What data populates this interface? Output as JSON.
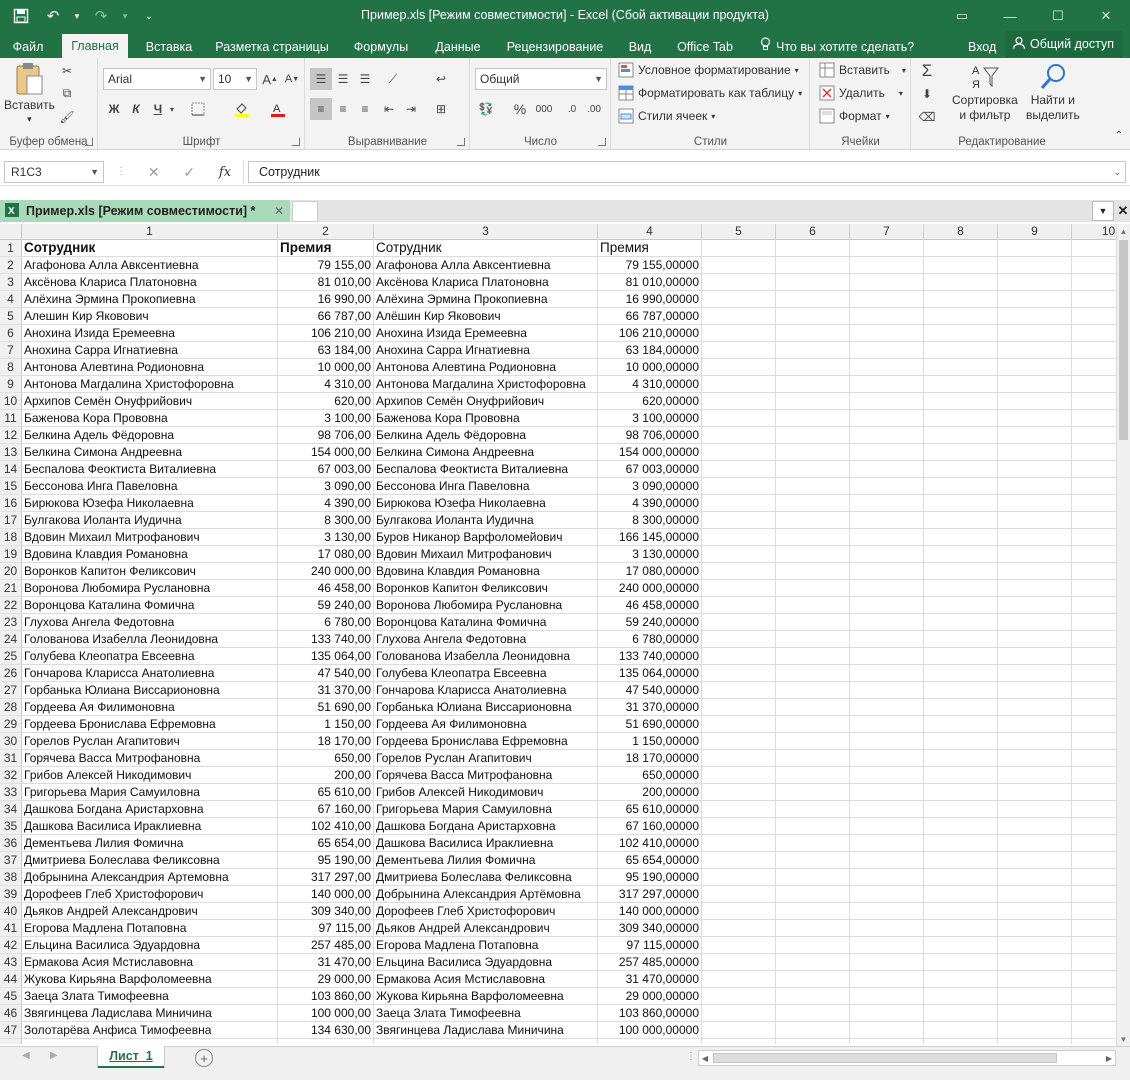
{
  "window": {
    "title": "Пример.xls  [Режим совместимости] - Excel (Сбой активации продукта)",
    "quick_access": [
      "save-icon",
      "undo-icon",
      "redo-icon",
      "customize-qat-icon"
    ]
  },
  "tabs": {
    "file": "Файл",
    "home": "Главная",
    "insert": "Вставка",
    "page_layout": "Разметка страницы",
    "formulas": "Формулы",
    "data": "Данные",
    "review": "Рецензирование",
    "view": "Вид",
    "office_tab": "Office Tab",
    "tell_me": "Что вы хотите сделать?",
    "sign_in": "Вход",
    "share": "Общий доступ"
  },
  "ribbon": {
    "clipboard": {
      "label": "Буфер обмена",
      "paste": "Вставить"
    },
    "font": {
      "label": "Шрифт",
      "font_name": "Arial",
      "font_size": "10",
      "bold": "Ж",
      "italic": "К",
      "underline": "Ч"
    },
    "alignment": {
      "label": "Выравнивание"
    },
    "number": {
      "label": "Число",
      "format": "Общий",
      "percent": "%",
      "thousands": "000"
    },
    "styles": {
      "label": "Стили",
      "conditional": "Условное форматирование",
      "as_table": "Форматировать как таблицу",
      "cell_styles": "Стили ячеек"
    },
    "cells": {
      "label": "Ячейки",
      "insert": "Вставить",
      "delete": "Удалить",
      "format": "Формат"
    },
    "editing": {
      "label": "Редактирование",
      "sort_line1": "Сортировка",
      "sort_line2": "и фильтр",
      "find_line1": "Найти и",
      "find_line2": "выделить"
    }
  },
  "formula_bar": {
    "name_box": "R1C3",
    "fx": "fx",
    "content": "Сотрудник"
  },
  "workbook_tab": {
    "name": "Пример.xls  [Режим совместимости] *"
  },
  "sheet": {
    "column_headers": [
      "1",
      "2",
      "3",
      "4",
      "5",
      "6",
      "7",
      "8",
      "9",
      "10"
    ],
    "header_row": [
      "Сотрудник",
      "Премия",
      "Сотрудник",
      "Премия"
    ],
    "rows": [
      [
        "Агафонова Алла Авксентиевна",
        "79 155,00",
        "Агафонова Алла Авксентиевна",
        "79 155,00000"
      ],
      [
        "Аксёнова Клариса Платоновна",
        "81 010,00",
        "Аксёнова Клариса Платоновна",
        "81 010,00000"
      ],
      [
        "Алёхина Эрмина Прокопиевна",
        "16 990,00",
        "Алёхина Эрмина Прокопиевна",
        "16 990,00000"
      ],
      [
        "Алешин Кир Яковович",
        "66 787,00",
        "Алёшин Кир Яковович",
        "66 787,00000"
      ],
      [
        "Анохина Изида Еремеевна",
        "106 210,00",
        "Анохина Изида Еремеевна",
        "106 210,00000"
      ],
      [
        "Анохина Сарра Игнатиевна",
        "63 184,00",
        "Анохина Сарра Игнатиевна",
        "63 184,00000"
      ],
      [
        "Антонова Алевтина Родионовна",
        "10 000,00",
        "Антонова Алевтина Родионовна",
        "10 000,00000"
      ],
      [
        "Антонова Магдалина Христофоровна",
        "4 310,00",
        "Антонова Магдалина Христофоровна",
        "4 310,00000"
      ],
      [
        "Архипов Семён Онуфрийович",
        "620,00",
        "Архипов Семён Онуфрийович",
        "620,00000"
      ],
      [
        "Баженова Кора Прововна",
        "3 100,00",
        "Баженова Кора Прововна",
        "3 100,00000"
      ],
      [
        "Белкина Адель Фёдоровна",
        "98 706,00",
        "Белкина Адель Фёдоровна",
        "98 706,00000"
      ],
      [
        "Белкина Симона Андреевна",
        "154 000,00",
        "Белкина Симона Андреевна",
        "154 000,00000"
      ],
      [
        "Беспалова Феоктиста Виталиевна",
        "67 003,00",
        "Беспалова Феоктиста Виталиевна",
        "67 003,00000"
      ],
      [
        "Бессонова Инга Павеловна",
        "3 090,00",
        "Бессонова Инга Павеловна",
        "3 090,00000"
      ],
      [
        "Бирюкова Юзефа Николаевна",
        "4 390,00",
        "Бирюкова Юзефа Николаевна",
        "4 390,00000"
      ],
      [
        "Булгакова Иоланта Иудична",
        "8 300,00",
        "Булгакова Иоланта Иудична",
        "8 300,00000"
      ],
      [
        "Вдовин Михаил Митрофанович",
        "3 130,00",
        "Буров Никанор Варфоломейович",
        "166 145,00000"
      ],
      [
        "Вдовина Клавдия Романовна",
        "17 080,00",
        "Вдовин Михаил Митрофанович",
        "3 130,00000"
      ],
      [
        "Воронков Капитон Феликсович",
        "240 000,00",
        "Вдовина Клавдия Романовна",
        "17 080,00000"
      ],
      [
        "Воронова Любомира Руслановна",
        "46 458,00",
        "Воронков Капитон Феликсович",
        "240 000,00000"
      ],
      [
        "Воронцова Каталина Фомична",
        "59 240,00",
        "Воронова Любомира Руслановна",
        "46 458,00000"
      ],
      [
        "Глухова Ангела Федотовна",
        "6 780,00",
        "Воронцова Каталина Фомична",
        "59 240,00000"
      ],
      [
        "Голованова Изабелла Леонидовна",
        "133 740,00",
        "Глухова Ангела Федотовна",
        "6 780,00000"
      ],
      [
        "Голубева Клеопатра Евсеевна",
        "135 064,00",
        "Голованова Изабелла Леонидовна",
        "133 740,00000"
      ],
      [
        "Гончарова Кларисса Анатолиевна",
        "47 540,00",
        "Голубева Клеопатра Евсеевна",
        "135 064,00000"
      ],
      [
        "Горбанька Юлиана Виссарионовна",
        "31 370,00",
        "Гончарова Кларисса Анатолиевна",
        "47 540,00000"
      ],
      [
        "Гордеева Ая Филимоновна",
        "51 690,00",
        "Горбанька Юлиана Виссарионовна",
        "31 370,00000"
      ],
      [
        "Гордеева Бронислава Ефремовна",
        "1 150,00",
        "Гордеева Ая Филимоновна",
        "51 690,00000"
      ],
      [
        "Горелов Руслан Агапитович",
        "18 170,00",
        "Гордеева Бронислава Ефремовна",
        "1 150,00000"
      ],
      [
        "Горячева Васса Митрофановна",
        "650,00",
        "Горелов Руслан Агапитович",
        "18 170,00000"
      ],
      [
        "Грибов Алексей Никодимович",
        "200,00",
        "Горячева Васса Митрофановна",
        "650,00000"
      ],
      [
        "Григорьева Мария Самуиловна",
        "65 610,00",
        "Грибов Алексей Никодимович",
        "200,00000"
      ],
      [
        "Дашкова Богдана Аристарховна",
        "67 160,00",
        "Григорьева Мария Самуиловна",
        "65 610,00000"
      ],
      [
        "Дашкова Василиса Ираклиевна",
        "102 410,00",
        "Дашкова Богдана Аристарховна",
        "67 160,00000"
      ],
      [
        "Дементьева Лилия Фомична",
        "65 654,00",
        "Дашкова Василиса Ираклиевна",
        "102 410,00000"
      ],
      [
        "Дмитриева Болеслава Феликсовна",
        "95 190,00",
        "Дементьева Лилия Фомична",
        "65 654,00000"
      ],
      [
        "Добрынина Александрия Артемовна",
        "317 297,00",
        "Дмитриева Болеслава Феликсовна",
        "95 190,00000"
      ],
      [
        "Дорофеев Глеб Христофорович",
        "140 000,00",
        "Добрынина Александрия Артёмовна",
        "317 297,00000"
      ],
      [
        "Дьяков Андрей Александрович",
        "309 340,00",
        "Дорофеев Глеб Христофорович",
        "140 000,00000"
      ],
      [
        "Егорова Мадлена Потаповна",
        "97 115,00",
        "Дьяков Андрей Александрович",
        "309 340,00000"
      ],
      [
        "Ельцина Василиса Эдуардовна",
        "257 485,00",
        "Егорова Мадлена Потаповна",
        "97 115,00000"
      ],
      [
        "Ермакова Асия Мстиславовна",
        "31 470,00",
        "Ельцина Василиса Эдуардовна",
        "257 485,00000"
      ],
      [
        "Жукова Кирьяна Варфоломеевна",
        "29 000,00",
        "Ермакова Асия Мстиславовна",
        "31 470,00000"
      ],
      [
        "Заеца Злата Тимофеевна",
        "103 860,00",
        "Жукова Кирьяна Варфоломеевна",
        "29 000,00000"
      ],
      [
        "Звягинцева Ладислава Миничина",
        "100 000,00",
        "Заеца Злата Тимофеевна",
        "103 860,00000"
      ],
      [
        "Золотарёва Анфиса Тимофеевна",
        "134 630,00",
        "Звягинцева Ладислава Миничина",
        "100 000,00000"
      ]
    ]
  },
  "sheet_tabs": {
    "active": "Лист_1"
  }
}
